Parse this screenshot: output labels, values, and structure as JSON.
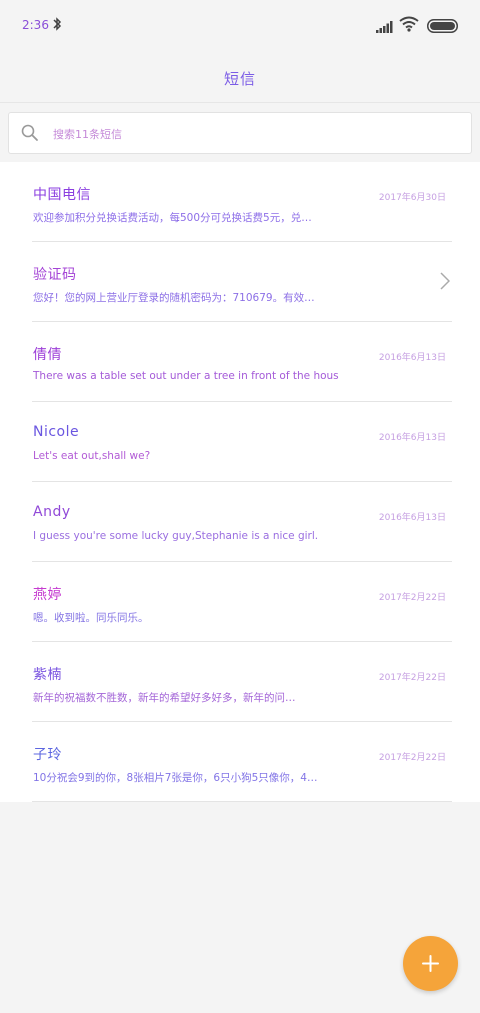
{
  "status_bar": {
    "time": "2:36"
  },
  "header": {
    "title": "短信"
  },
  "search": {
    "placeholder": "搜索11条短信"
  },
  "colors": {
    "accent": "#f5a43a",
    "name_purple": "#8b3fe0",
    "name_blue": "#5d67e0",
    "name_magenta": "#c53bd0"
  },
  "messages": [
    {
      "name": "中国电信",
      "date": "2017年6月30日",
      "preview": "欢迎参加积分兑换话费活动，每500分可兑换话费5元，兑…",
      "name_color": "#8b3fe0",
      "preview_color": "#8d6ee8"
    },
    {
      "name": "验证码",
      "date": "",
      "preview": "您好！您的网上营业厅登录的随机密码为：710679。有效…",
      "name_color": "#a444d6",
      "preview_color": "#8c6fe6"
    },
    {
      "name": "倩倩",
      "date": "2016年6月13日",
      "preview": "There was a table set out under a tree in front of the hous",
      "name_color": "#9c3ed8",
      "preview_color": "#a45ad8"
    },
    {
      "name": "Nicole",
      "date": "2016年6月13日",
      "preview": "Let's eat out,shall we?",
      "name_color": "#6a56e0",
      "preview_color": "#b25bd6"
    },
    {
      "name": "Andy",
      "date": "2016年6月13日",
      "preview": "I guess you're some lucky guy,Stephanie is a nice girl.",
      "name_color": "#9149d8",
      "preview_color": "#9a6ee0"
    },
    {
      "name": "燕婷",
      "date": "2017年2月22日",
      "preview": "嗯。收到啦。同乐同乐。",
      "name_color": "#c53bd0",
      "preview_color": "#8474e4"
    },
    {
      "name": "紫楠",
      "date": "2017年2月22日",
      "preview": "新年的祝福数不胜数，新年的希望好多好多，新年的问…",
      "name_color": "#7a54e0",
      "preview_color": "#a466d8"
    },
    {
      "name": "子玲",
      "date": "2017年2月22日",
      "preview": "10分祝会9到的你，8张相片7张是你，6只小狗5只像你，4…",
      "name_color": "#5d67e0",
      "preview_color": "#8274e6"
    }
  ]
}
